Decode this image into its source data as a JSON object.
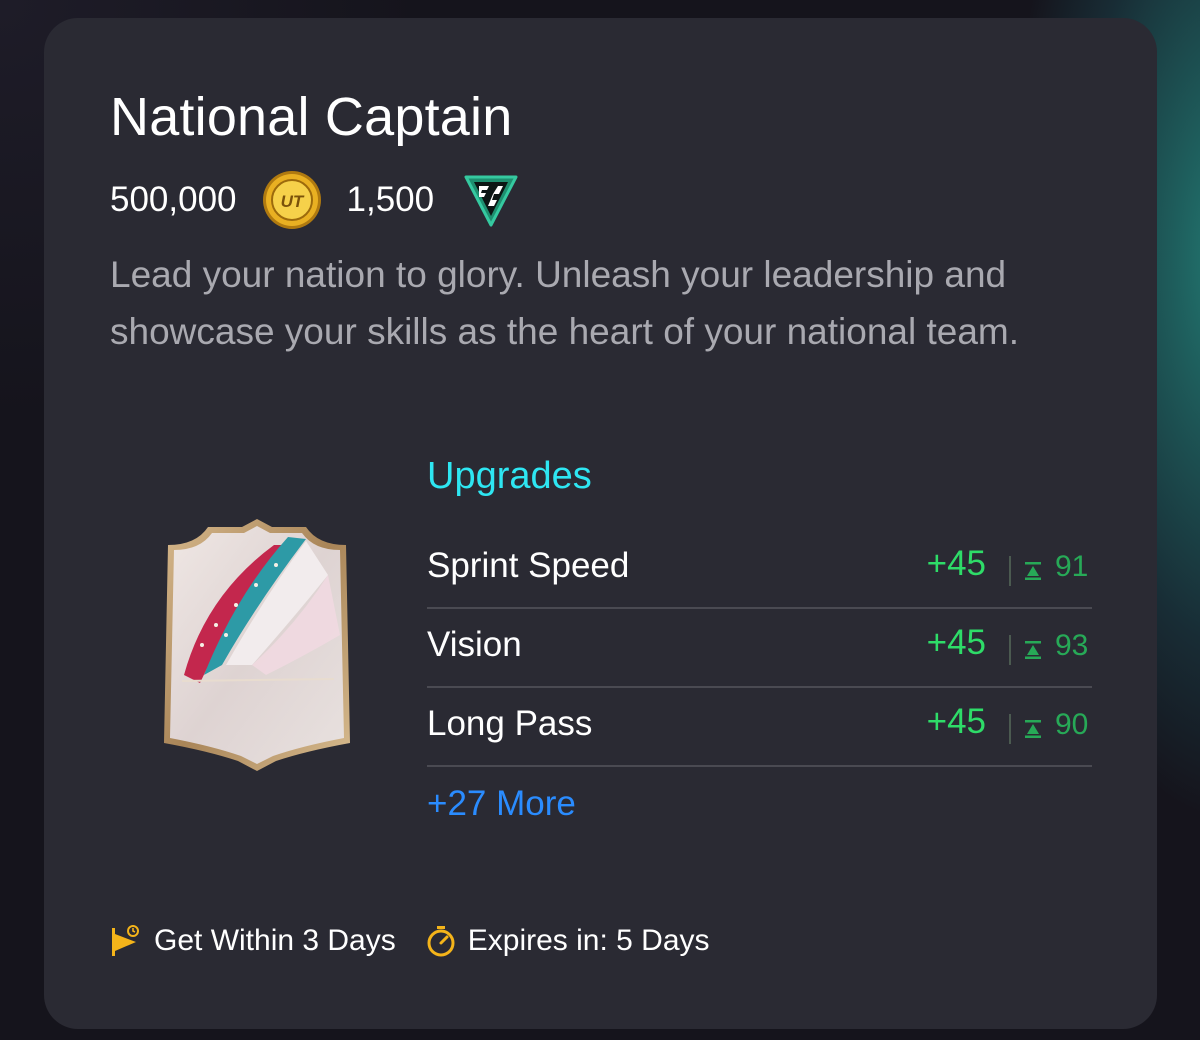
{
  "objective": {
    "title": "National Captain",
    "coin_price": "500,000",
    "points_price": "1,500",
    "description": "Lead your nation to glory. Unleash your leadership and showcase your skills as the heart of your national team.",
    "icons": {
      "coins": "ut-coin-icon",
      "points": "fc-points-icon",
      "card": "player-card-icon"
    }
  },
  "upgrades": {
    "heading": "Upgrades",
    "items": [
      {
        "name": "Sprint Speed",
        "boost": "+45",
        "max": "91"
      },
      {
        "name": "Vision",
        "boost": "+45",
        "max": "93"
      },
      {
        "name": "Long Pass",
        "boost": "+45",
        "max": "90"
      }
    ],
    "more_label": "+27 More"
  },
  "footer": {
    "get_within": "Get Within 3 Days",
    "expires": "Expires in: 5 Days"
  },
  "colors": {
    "panel": "#2a2a33",
    "heading_accent": "#2ee6f2",
    "boost_green": "#2edc68",
    "link_blue": "#2a8cff",
    "icon_gold": "#f4b41a"
  }
}
